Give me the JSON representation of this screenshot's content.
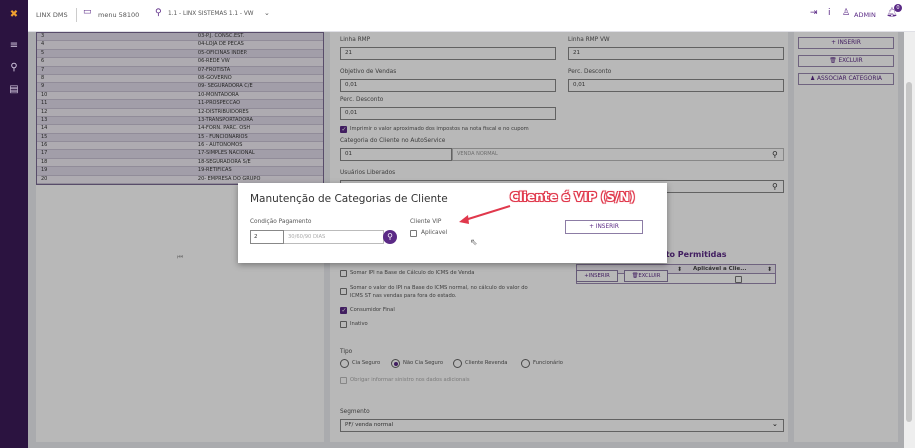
{
  "topbar": {
    "app_name": "LINX DMS",
    "menu": "menu 58100",
    "branch": "1.1 - LINX SISTEMAS 1.1 - VW",
    "user": "ADMIN",
    "notif_count": "0"
  },
  "grid": {
    "rows": [
      {
        "code": "3",
        "desc": "03-P.J. CONSC.EST."
      },
      {
        "code": "4",
        "desc": "04-LOJA DE PECAS"
      },
      {
        "code": "5",
        "desc": "05-OFICINAS INDEP."
      },
      {
        "code": "6",
        "desc": "06-REDE VW"
      },
      {
        "code": "7",
        "desc": "07-FROTISTA"
      },
      {
        "code": "8",
        "desc": "08-GOVERNO"
      },
      {
        "code": "9",
        "desc": "09- SEGURADORA C/E"
      },
      {
        "code": "10",
        "desc": "10-MONTADORA"
      },
      {
        "code": "11",
        "desc": "11-PROSPECCAO"
      },
      {
        "code": "12",
        "desc": "12-DISTRIBUIDORES"
      },
      {
        "code": "13",
        "desc": "13-TRANSPORTADORA"
      },
      {
        "code": "14",
        "desc": "14-FORN. PARC. OSH"
      },
      {
        "code": "15",
        "desc": "15 - FUNCIONARIOS"
      },
      {
        "code": "16",
        "desc": "16 - AUTONOMOS"
      },
      {
        "code": "17",
        "desc": "17-SIMPLES NACIONAL"
      },
      {
        "code": "18",
        "desc": "18-SEGURADORA S/E"
      },
      {
        "code": "19",
        "desc": "19-RETIFICAS"
      },
      {
        "code": "20",
        "desc": "20- EMPRESA DO GRUPO"
      }
    ],
    "pager_first": "⏮"
  },
  "form": {
    "linha_rmp_label": "Linha RMP",
    "linha_rmp_value": "21",
    "linha_rmp_vw_label": "Linha RMP VW",
    "linha_rmp_vw_value": "21",
    "objetivo_label": "Objetivo de Vendas",
    "objetivo_value": "0,01",
    "perc_desc_label": "Perc. Desconto",
    "perc_desc_value": "0,01",
    "perc_desc2_label": "Perc. Desconto",
    "perc_desc2_value": "0,01",
    "imprimir_label": "Imprimir o valor aproximado dos impostos na nota fiscal e no cupom",
    "categoria_label": "Categoria do Cliente no AutoService",
    "categoria_code": "01",
    "categoria_desc": "VENDA NORMAL",
    "usuarios_label": "Usuários Liberados",
    "permitidas_label": "nto Permitidas",
    "aplicavel_header": "Aplicável a Clie...",
    "somar_ipi_label": "Somar IPI na Base de Cálculo do ICMS de Venda",
    "somar_ipi2_label": "Somar o valor do IPI na Base do ICMS normal, no cálculo do valor do",
    "somar_ipi2_label_b": "ICMS ST nas vendas para fora do estado.",
    "consumidor_label": "Consumidor Final",
    "inativo_label": "Inativo",
    "inserir_small": "+INSERIR",
    "excluir_small": "EXCLUIR",
    "tipo_label": "Tipo",
    "tipo_options": [
      "Cia Seguro",
      "Não Cia Seguro",
      "Cliente Revenda",
      "Funcionário"
    ],
    "obrigar_label": "Obrigar informar sinistro nos dados adicionais",
    "segmento_label": "Segmento",
    "segmento_value": "PF/ venda normal"
  },
  "right": {
    "inserir": "+ INSERIR",
    "excluir": "EXCLUIR",
    "associar": "ASSOCIAR CATEGORIA"
  },
  "modal": {
    "title": "Manutenção de Categorias de Cliente",
    "cond_label": "Condição Pagamento",
    "cond_code": "2",
    "cond_desc": "30/60/90 DIAS",
    "vip_label": "Cliente VIP",
    "aplicavel_label": "Aplicavel",
    "inserir": "+ INSERIR"
  },
  "annotation": "Cliente é VIP (S/N)",
  "colors": {
    "accent": "#5b2a86",
    "rail": "#2b1340",
    "annotation": "#e0384c"
  }
}
